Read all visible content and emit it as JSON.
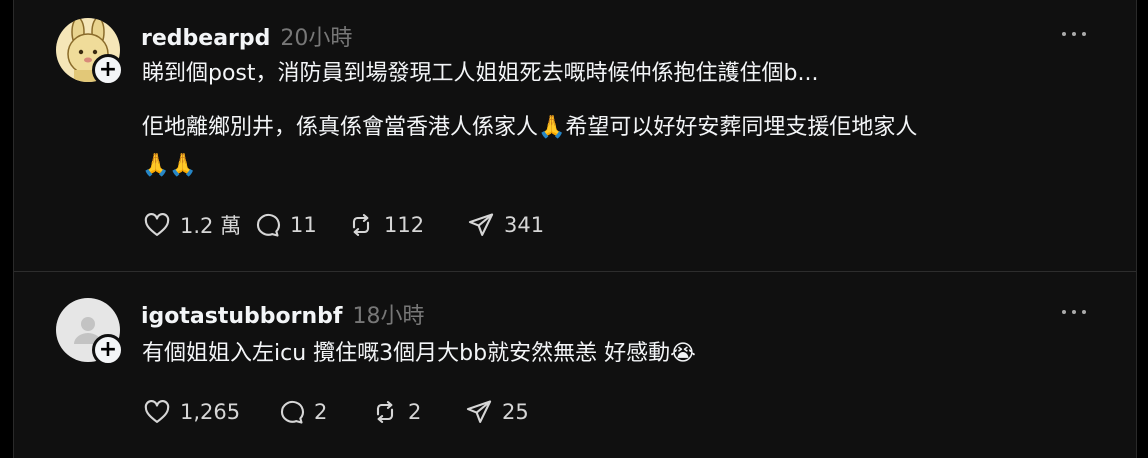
{
  "posts": [
    {
      "username": "redbearpd",
      "time": "20小時",
      "lines": [
        "睇到個post，消防員到場發現工人姐姐死去嘅時候仲係抱住護住個b...",
        "佢地離鄉別井，係真係會當香港人係家人🙏希望可以好好安葬同埋支援佢地家人",
        "🙏🙏"
      ],
      "likes": "1.2 萬",
      "comments": "11",
      "reposts": "112",
      "shares": "341"
    },
    {
      "username": "igotastubbornbf",
      "time": "18小時",
      "lines": [
        "有個姐姐入左icu 攬住嘅3個月大bb就安然無恙 好感動😭"
      ],
      "likes": "1,265",
      "comments": "2",
      "reposts": "2",
      "shares": "25"
    }
  ],
  "follow_symbol": "+",
  "icons": {
    "like": "heart-icon",
    "comment": "comment-icon",
    "repost": "repost-icon",
    "share": "send-icon",
    "more": "more-icon"
  },
  "colors": {
    "background": "#101010",
    "text": "#f3f5f7",
    "muted": "#777777"
  }
}
